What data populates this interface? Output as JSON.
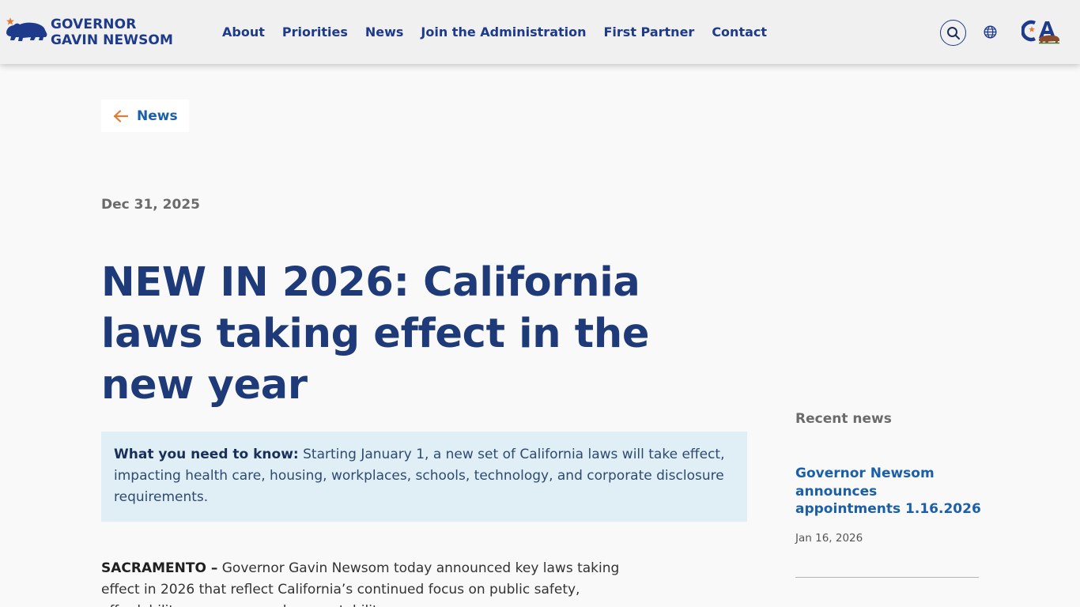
{
  "header": {
    "logo_line1": "GOVERNOR",
    "logo_line2": "GAVIN NEWSOM",
    "nav": [
      {
        "label": "About"
      },
      {
        "label": "Priorities"
      },
      {
        "label": "News"
      },
      {
        "label": "Join the Administration"
      },
      {
        "label": "First Partner"
      },
      {
        "label": "Contact"
      }
    ],
    "icons": {
      "search": "search-icon",
      "language": "globe-icon",
      "ca_logo": "ca-logo"
    }
  },
  "breadcrumb": {
    "back_label": "News",
    "arrow_icon": "arrow-left-icon"
  },
  "article": {
    "date": "Dec 31, 2025",
    "title": "NEW IN 2026: California laws taking effect in the new year",
    "callout_lead": "What you need to know:",
    "callout_text": " Starting January 1, a new set of California laws will take effect, impacting health care, housing, workplaces, schools, technology, and corporate disclosure requirements.",
    "body_lead": "SACRAMENTO –",
    "body_text": " Governor Gavin Newsom today announced key laws taking effect in 2026 that reflect California’s continued focus on public safety, affordability, consumer and accountability"
  },
  "sidebar": {
    "heading": "Recent news",
    "items": [
      {
        "title": "Governor Newsom announces appointments 1.16.2026",
        "date": "Jan 16, 2026"
      }
    ]
  },
  "colors": {
    "navy": "#1e3a8a",
    "link_blue": "#1a5fa8",
    "accent_orange": "#e07b39",
    "callout_bg": "#e0eff6",
    "header_bg": "#f0f0f0"
  }
}
